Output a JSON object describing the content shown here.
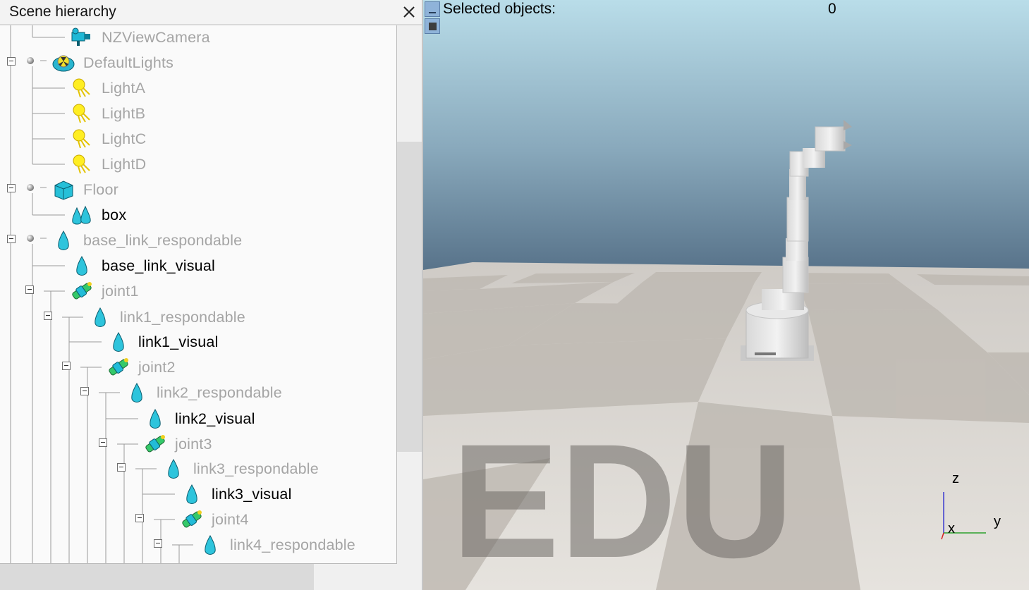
{
  "panel": {
    "title": "Scene hierarchy",
    "close_icon": "close-icon",
    "items": [
      {
        "label": "NZViewCamera",
        "icon": "camera-icon",
        "active": false
      },
      {
        "label": "DefaultLights",
        "icon": "lights-group-icon",
        "active": false
      },
      {
        "label": "LightA",
        "icon": "light-icon",
        "active": false
      },
      {
        "label": "LightB",
        "icon": "light-icon",
        "active": false
      },
      {
        "label": "LightC",
        "icon": "light-icon",
        "active": false
      },
      {
        "label": "LightD",
        "icon": "light-icon",
        "active": false
      },
      {
        "label": "Floor",
        "icon": "dummy-cube-icon",
        "active": false
      },
      {
        "label": "box",
        "icon": "shape-group-icon",
        "active": true
      },
      {
        "label": "base_link_respondable",
        "icon": "shape-icon",
        "active": false
      },
      {
        "label": "base_link_visual",
        "icon": "shape-icon",
        "active": true
      },
      {
        "label": "joint1",
        "icon": "joint-icon",
        "active": false
      },
      {
        "label": "link1_respondable",
        "icon": "shape-icon",
        "active": false
      },
      {
        "label": "link1_visual",
        "icon": "shape-icon",
        "active": true
      },
      {
        "label": "joint2",
        "icon": "joint-icon",
        "active": false
      },
      {
        "label": "link2_respondable",
        "icon": "shape-icon",
        "active": false
      },
      {
        "label": "link2_visual",
        "icon": "shape-icon",
        "active": true
      },
      {
        "label": "joint3",
        "icon": "joint-icon",
        "active": false
      },
      {
        "label": "link3_respondable",
        "icon": "shape-icon",
        "active": false
      },
      {
        "label": "link3_visual",
        "icon": "shape-icon",
        "active": true
      },
      {
        "label": "joint4",
        "icon": "joint-icon",
        "active": false
      },
      {
        "label": "link4_respondable",
        "icon": "shape-icon",
        "active": false
      }
    ]
  },
  "viewport": {
    "selected_label": "Selected objects:",
    "selected_count": "0",
    "watermark": "EDU",
    "axes": {
      "z": "z",
      "y": "y",
      "x": "x"
    },
    "colors": {
      "sky_top": "#b8dce8",
      "sky_bottom": "#5e7a8e",
      "floor_light": "#d9d6d1",
      "floor_dark": "#c3bfb9"
    }
  }
}
